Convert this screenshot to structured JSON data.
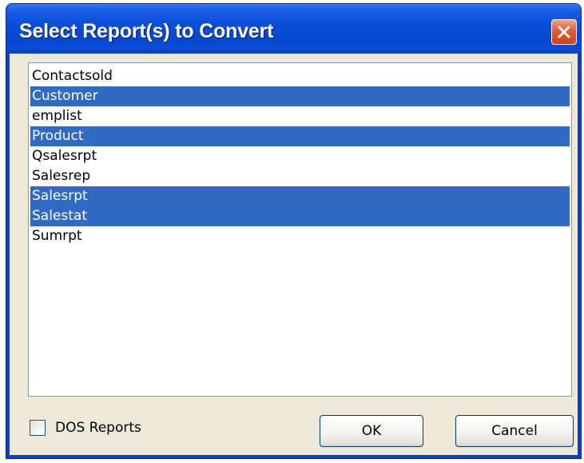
{
  "window": {
    "title": "Select Report(s) to Convert"
  },
  "reports": {
    "items": [
      {
        "label": "Contactsold",
        "selected": false
      },
      {
        "label": "Customer",
        "selected": true
      },
      {
        "label": "emplist",
        "selected": false
      },
      {
        "label": "Product",
        "selected": true
      },
      {
        "label": "Qsalesrpt",
        "selected": false
      },
      {
        "label": "Salesrep",
        "selected": false
      },
      {
        "label": "Salesrpt",
        "selected": true
      },
      {
        "label": "Salestat",
        "selected": true
      },
      {
        "label": "Sumrpt",
        "selected": false
      }
    ]
  },
  "options": {
    "dos_reports_label": "DOS Reports",
    "dos_reports_checked": false
  },
  "buttons": {
    "ok_label": "OK",
    "cancel_label": "Cancel"
  },
  "colors": {
    "title_bar": "#0842c8",
    "selection": "#316ac5",
    "close_button": "#e25c36",
    "dialog_face": "#ece9d8"
  },
  "icons": {
    "close": "close-x-icon"
  }
}
